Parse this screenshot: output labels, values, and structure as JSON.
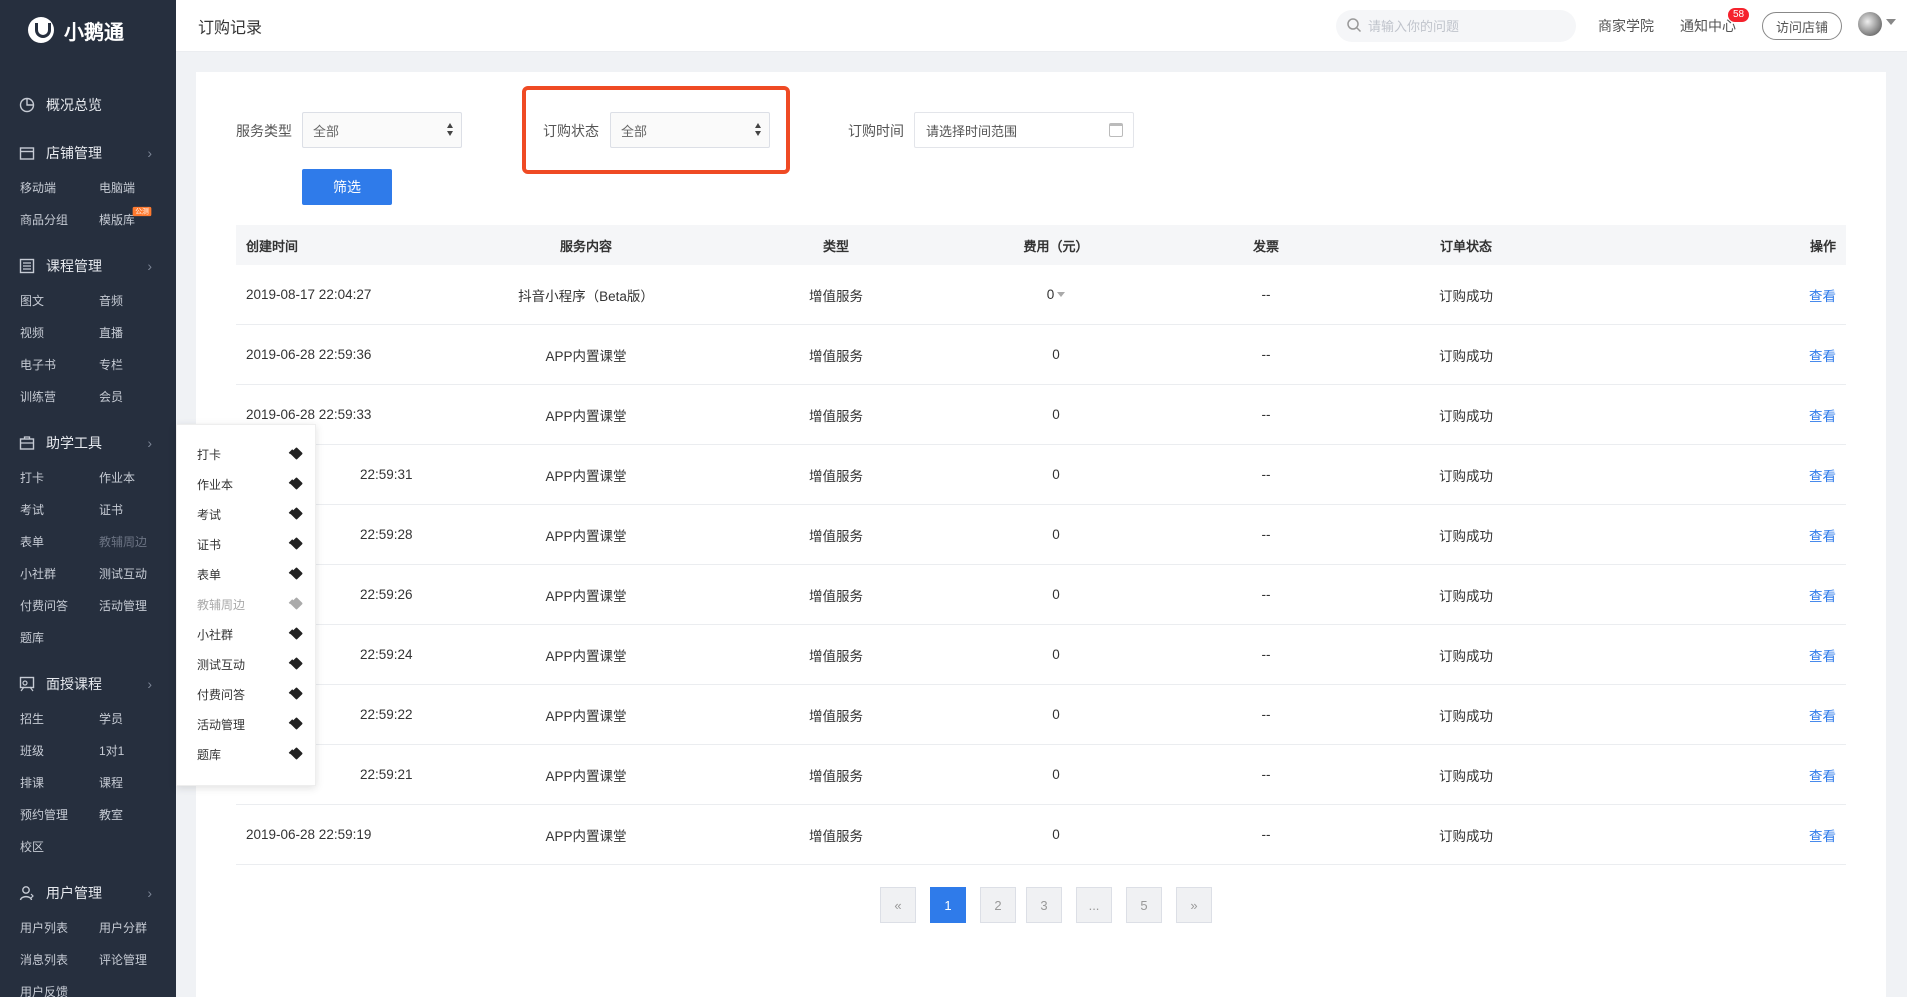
{
  "app": {
    "name": "小鹅通"
  },
  "sidebar": {
    "sections": [
      {
        "title": "概况总览",
        "icon": "pie-chart-icon",
        "items": []
      },
      {
        "title": "店铺管理",
        "icon": "store-icon",
        "items": [
          "移动端",
          "电脑端",
          "商品分组",
          "模版库"
        ]
      },
      {
        "title": "课程管理",
        "icon": "list-icon",
        "items": [
          "图文",
          "音频",
          "视频",
          "直播",
          "电子书",
          "专栏",
          "训练营",
          "会员"
        ]
      },
      {
        "title": "助学工具",
        "icon": "toolbox-icon",
        "items": [
          "打卡",
          "作业本",
          "考试",
          "证书",
          "表单",
          "教辅周边",
          "小社群",
          "测试互动",
          "付费问答",
          "活动管理",
          "题库"
        ]
      },
      {
        "title": "面授课程",
        "icon": "classroom-icon",
        "items": [
          "招生",
          "学员",
          "班级",
          "1对1",
          "排课",
          "课程",
          "预约管理",
          "教室",
          "校区"
        ]
      },
      {
        "title": "用户管理",
        "icon": "user-icon",
        "items": [
          "用户列表",
          "用户分群",
          "消息列表",
          "评论管理",
          "用户反馈"
        ]
      }
    ],
    "template_badge": "公测"
  },
  "header": {
    "title": "订购记录",
    "search_placeholder": "请输入你的问题",
    "academy": "商家学院",
    "notifications": "通知中心",
    "notification_count": "58",
    "visit_store": "访问店铺"
  },
  "filters": {
    "service_type_label": "服务类型",
    "service_type_value": "全部",
    "order_status_label": "订购状态",
    "order_status_value": "全部",
    "order_time_label": "订购时间",
    "order_time_placeholder": "请选择时间范围",
    "filter_button": "筛选"
  },
  "table": {
    "headers": [
      "创建时间",
      "服务内容",
      "类型",
      "费用（元）",
      "发票",
      "订单状态",
      "操作"
    ],
    "rows": [
      {
        "time": "2019-08-17 22:04:27",
        "service": "抖音小程序（Beta版）",
        "type": "增值服务",
        "fee": "0",
        "invoice": "--",
        "status": "订购成功",
        "action": "查看"
      },
      {
        "time": "2019-06-28 22:59:36",
        "service": "APP内置课堂",
        "type": "增值服务",
        "fee": "0",
        "invoice": "--",
        "status": "订购成功",
        "action": "查看"
      },
      {
        "time": "2019-06-28 22:59:33",
        "service": "APP内置课堂",
        "type": "增值服务",
        "fee": "0",
        "invoice": "--",
        "status": "订购成功",
        "action": "查看"
      },
      {
        "time": "22:59:31",
        "service": "APP内置课堂",
        "type": "增值服务",
        "fee": "0",
        "invoice": "--",
        "status": "订购成功",
        "action": "查看"
      },
      {
        "time": "22:59:28",
        "service": "APP内置课堂",
        "type": "增值服务",
        "fee": "0",
        "invoice": "--",
        "status": "订购成功",
        "action": "查看"
      },
      {
        "time": "22:59:26",
        "service": "APP内置课堂",
        "type": "增值服务",
        "fee": "0",
        "invoice": "--",
        "status": "订购成功",
        "action": "查看"
      },
      {
        "time": "22:59:24",
        "service": "APP内置课堂",
        "type": "增值服务",
        "fee": "0",
        "invoice": "--",
        "status": "订购成功",
        "action": "查看"
      },
      {
        "time": "22:59:22",
        "service": "APP内置课堂",
        "type": "增值服务",
        "fee": "0",
        "invoice": "--",
        "status": "订购成功",
        "action": "查看"
      },
      {
        "time": "22:59:21",
        "service": "APP内置课堂",
        "type": "增值服务",
        "fee": "0",
        "invoice": "--",
        "status": "订购成功",
        "action": "查看"
      },
      {
        "time": "2019-06-28 22:59:19",
        "service": "APP内置课堂",
        "type": "增值服务",
        "fee": "0",
        "invoice": "--",
        "status": "订购成功",
        "action": "查看"
      }
    ]
  },
  "pagination": {
    "prev": "«",
    "pages": [
      "1",
      "2",
      "3",
      "...",
      "5"
    ],
    "next": "»",
    "current": "1"
  },
  "flyout": {
    "items": [
      "打卡",
      "作业本",
      "考试",
      "证书",
      "表单",
      "教辅周边",
      "小社群",
      "测试互动",
      "付费问答",
      "活动管理",
      "题库"
    ],
    "dim_item": "教辅周边"
  },
  "colors": {
    "sidebar_bg": "#262f3e",
    "accent": "#2f7bea",
    "highlight": "#ef4a24",
    "badge": "#f5222d"
  }
}
